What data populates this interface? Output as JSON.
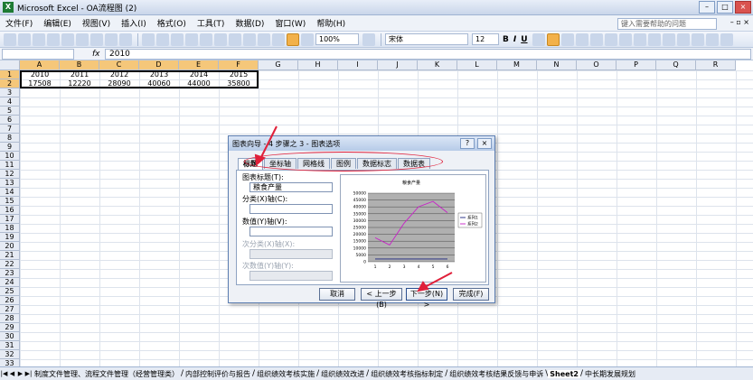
{
  "window": {
    "title": "Microsoft Excel - OA流程图 (2)"
  },
  "menu": {
    "items": [
      "文件(F)",
      "编辑(E)",
      "视图(V)",
      "插入(I)",
      "格式(O)",
      "工具(T)",
      "数据(D)",
      "窗口(W)",
      "帮助(H)"
    ],
    "help_placeholder": "键入需要帮助的问题"
  },
  "toolbar": {
    "zoom": "100%",
    "font": "宋体",
    "font_size": "12",
    "bold": "B",
    "italic": "I",
    "underline": "U"
  },
  "formula_bar": {
    "name_box": "",
    "fx": "fx",
    "value": "2010"
  },
  "sheet": {
    "columns": [
      "A",
      "B",
      "C",
      "D",
      "E",
      "F",
      "G",
      "H",
      "I",
      "J",
      "K",
      "L",
      "M",
      "N",
      "O",
      "P",
      "Q",
      "R"
    ],
    "row_count": 33,
    "rows": [
      [
        "2010",
        "2011",
        "2012",
        "2013",
        "2014",
        "2015"
      ],
      [
        "17508",
        "12220",
        "28090",
        "40060",
        "44000",
        "35800"
      ]
    ]
  },
  "dialog": {
    "title": "图表向导 - 4 步骤之 3 - 图表选项",
    "help_btn": "?",
    "close_btn": "×",
    "tabs": [
      "标题",
      "坐标轴",
      "网格线",
      "图例",
      "数据标志",
      "数据表"
    ],
    "fields": {
      "chart_title_label": "图表标题(T):",
      "chart_title_value": "粮食产量",
      "category_x_label": "分类(X)轴(C):",
      "value_y_label": "数值(Y)轴(V):",
      "secondary_x_label": "次分类(X)轴(X):",
      "secondary_y_label": "次数值(Y)轴(Y):"
    },
    "buttons": {
      "cancel": "取消",
      "back": "< 上一步(B)",
      "next": "下一步(N) >",
      "finish": "完成(F)"
    }
  },
  "chart_data": {
    "type": "line",
    "title": "粮食产量",
    "categories": [
      "1",
      "2",
      "3",
      "4",
      "5",
      "6"
    ],
    "series": [
      {
        "name": "系列1",
        "values": [
          2010,
          2011,
          2012,
          2013,
          2014,
          2015
        ],
        "color": "#1a237e"
      },
      {
        "name": "系列2",
        "values": [
          17508,
          12220,
          28090,
          40060,
          44000,
          35800
        ],
        "color": "#c81fc8"
      }
    ],
    "yticks": [
      "50000",
      "45000",
      "40000",
      "35000",
      "30000",
      "25000",
      "20000",
      "15000",
      "10000",
      "5000",
      "0"
    ],
    "ylim": [
      0,
      50000
    ],
    "grid": true,
    "legend": "right",
    "plot_bg": "#b0b0b0"
  },
  "sheet_tabs": [
    "制度文件管理、流程文件管理（经营管理类）",
    "内部控制评价与报告",
    "组织绩效考核实施",
    "组织绩效改进",
    "组织绩效考核指标制定",
    "组织绩效考核结果反馈与申诉",
    "Sheet2",
    "中长期发展规划"
  ],
  "colors": {
    "annotation": "#e0203a",
    "selection_header": "#f5c77a"
  }
}
